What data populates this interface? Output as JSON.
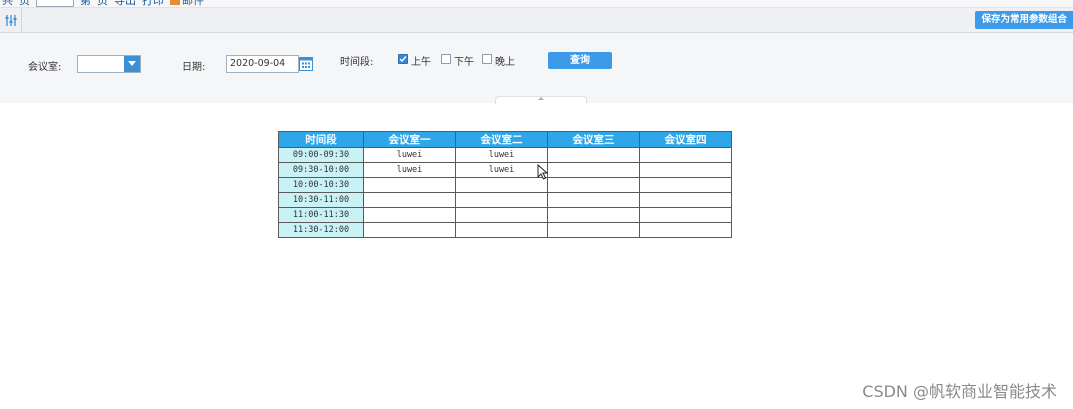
{
  "toolbar": {
    "items": [
      "共",
      "页",
      "第",
      "页",
      "导出",
      "打印",
      "邮件"
    ],
    "page_input": ""
  },
  "save_params_label": "保存为常用参数组合",
  "params": {
    "room_label": "会议室:",
    "room_value": "",
    "date_label": "日期:",
    "date_value": "2020-09-04",
    "period_label": "时间段:",
    "periods": [
      {
        "label": "上午",
        "checked": true
      },
      {
        "label": "下午",
        "checked": false
      },
      {
        "label": "晚上",
        "checked": false
      }
    ],
    "query_label": "查询"
  },
  "table": {
    "headers": [
      "时间段",
      "会议室一",
      "会议室二",
      "会议室三",
      "会议室四"
    ],
    "rows": [
      [
        "09:00-09:30",
        "luwei",
        "luwei",
        "",
        ""
      ],
      [
        "09:30-10:00",
        "luwei",
        "luwei",
        "",
        ""
      ],
      [
        "10:00-10:30",
        "",
        "",
        "",
        ""
      ],
      [
        "10:30-11:00",
        "",
        "",
        "",
        ""
      ],
      [
        "11:00-11:30",
        "",
        "",
        "",
        ""
      ],
      [
        "11:30-12:00",
        "",
        "",
        "",
        ""
      ]
    ]
  },
  "watermark": "CSDN @帆软商业智能技术",
  "colors": {
    "accent": "#3d9ae8",
    "header_bg": "#2fa6e8",
    "time_cell_bg": "#c9f2f7"
  }
}
